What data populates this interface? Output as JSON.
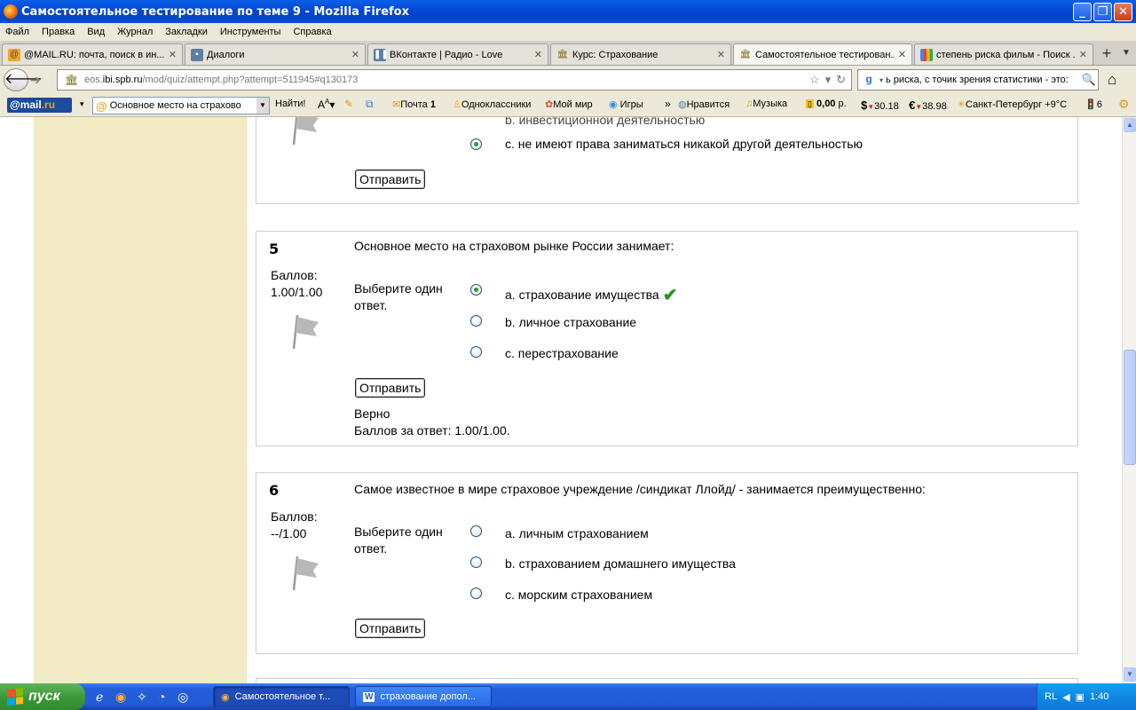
{
  "window": {
    "title": "Самостоятельное тестирование по теме 9 - Mozilla Firefox"
  },
  "menu": [
    "Файл",
    "Правка",
    "Вид",
    "Журнал",
    "Закладки",
    "Инструменты",
    "Справка"
  ],
  "tabs": [
    {
      "label": "@MAIL.RU: почта, поиск в ин...",
      "icon": "mail-icon"
    },
    {
      "label": "Диалоги",
      "icon": "chat-icon"
    },
    {
      "label": "ВКонтакте | Радио - Love",
      "icon": "pause-icon"
    },
    {
      "label": "Курс: Страхование",
      "icon": "moodle-icon"
    },
    {
      "label": "Самостоятельное тестирован...",
      "icon": "moodle-icon",
      "active": true
    },
    {
      "label": "степень риска фильм - Поиск ...",
      "icon": "google-icon"
    }
  ],
  "nav": {
    "url_prefix": "eos.",
    "url_domain": "ibi.spb.ru",
    "url_path": "/mod/quiz/attempt.php?attempt=511945#q130173",
    "search_query": "ь риска, с точик зрения статистики - это:"
  },
  "mailbar": {
    "search_text": "Основное место на страхово",
    "find": "Найти!",
    "mail": "Почта",
    "mail_count": "1",
    "ok": "Одноклассники",
    "mymir": "Мой мир",
    "games": "Игры",
    "more": "»",
    "likes": "Нравится",
    "music": "Музыка",
    "balance": "0,00",
    "balance_unit": "р.",
    "usd": "30.18",
    "eur": "38.98",
    "weather": "Санкт-Петербург +9°C",
    "traffic": "6"
  },
  "quiz": {
    "partial": {
      "option_b_fragment": "b. инвестиционной деятельностью",
      "option_c": "c. не имеют права заниматься никакой другой деятельностью",
      "send": "Отправить"
    },
    "questions": [
      {
        "number": "5",
        "grade_label": "Баллов:",
        "grade_value": "1.00/1.00",
        "text": "Основное место на страховом рынке России занимает:",
        "prompt": "Выберите один ответ.",
        "options": [
          {
            "label": "a. страхование имущества",
            "selected": true,
            "correct": true
          },
          {
            "label": "b. личное страхование",
            "selected": false
          },
          {
            "label": "c. перестрахование",
            "selected": false
          }
        ],
        "send": "Отправить",
        "feedback": "Верно",
        "score": "Баллов за ответ: 1.00/1.00."
      },
      {
        "number": "6",
        "grade_label": "Баллов:",
        "grade_value": "--/1.00",
        "text": "Самое известное в мире страховое учреждение /синдикат Ллойд/ - занимается преимущественно:",
        "prompt": "Выберите один ответ.",
        "options": [
          {
            "label": "a. личным страхованием",
            "selected": false
          },
          {
            "label": "b. страхованием домашнего имущества",
            "selected": false
          },
          {
            "label": "c. морским страхованием",
            "selected": false
          }
        ],
        "send": "Отправить"
      }
    ]
  },
  "taskbar": {
    "start": "пуск",
    "tasks": [
      {
        "label": "Самостоятельное т...",
        "icon": "firefox-icon"
      },
      {
        "label": "страхование допол...",
        "icon": "word-icon"
      }
    ],
    "lang": "RL",
    "time": "1:40"
  },
  "colors": {
    "titlebar": "#0549d6",
    "sidebar": "#f2ebc5",
    "check": "#1f9a26",
    "taskbar": "#245edb",
    "start": "#3c9a3a"
  }
}
